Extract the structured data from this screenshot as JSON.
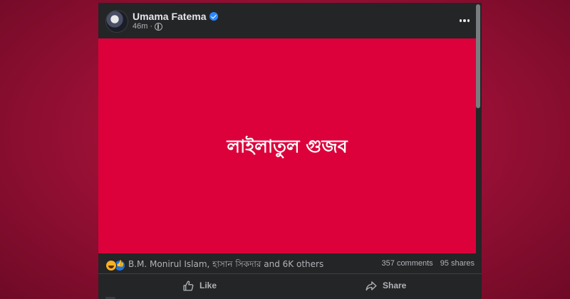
{
  "post": {
    "author": "Umama Fatema",
    "time": "46m",
    "separator": "·",
    "image_text": "লাইলাতুল গুজব",
    "reactors": "B.M. Monirul Islam, হাসান সিকদার and 6K others",
    "comments": "357 comments",
    "shares": "95 shares",
    "like_label": "Like",
    "share_label": "Share",
    "accent": "#dc013b",
    "background": "#242526",
    "verified_color": "#2d88ff"
  },
  "icons": [
    "verified-badge-icon",
    "globe-icon",
    "more-options-icon",
    "haha-reaction-icon",
    "like-reaction-icon",
    "like-icon",
    "share-icon"
  ]
}
